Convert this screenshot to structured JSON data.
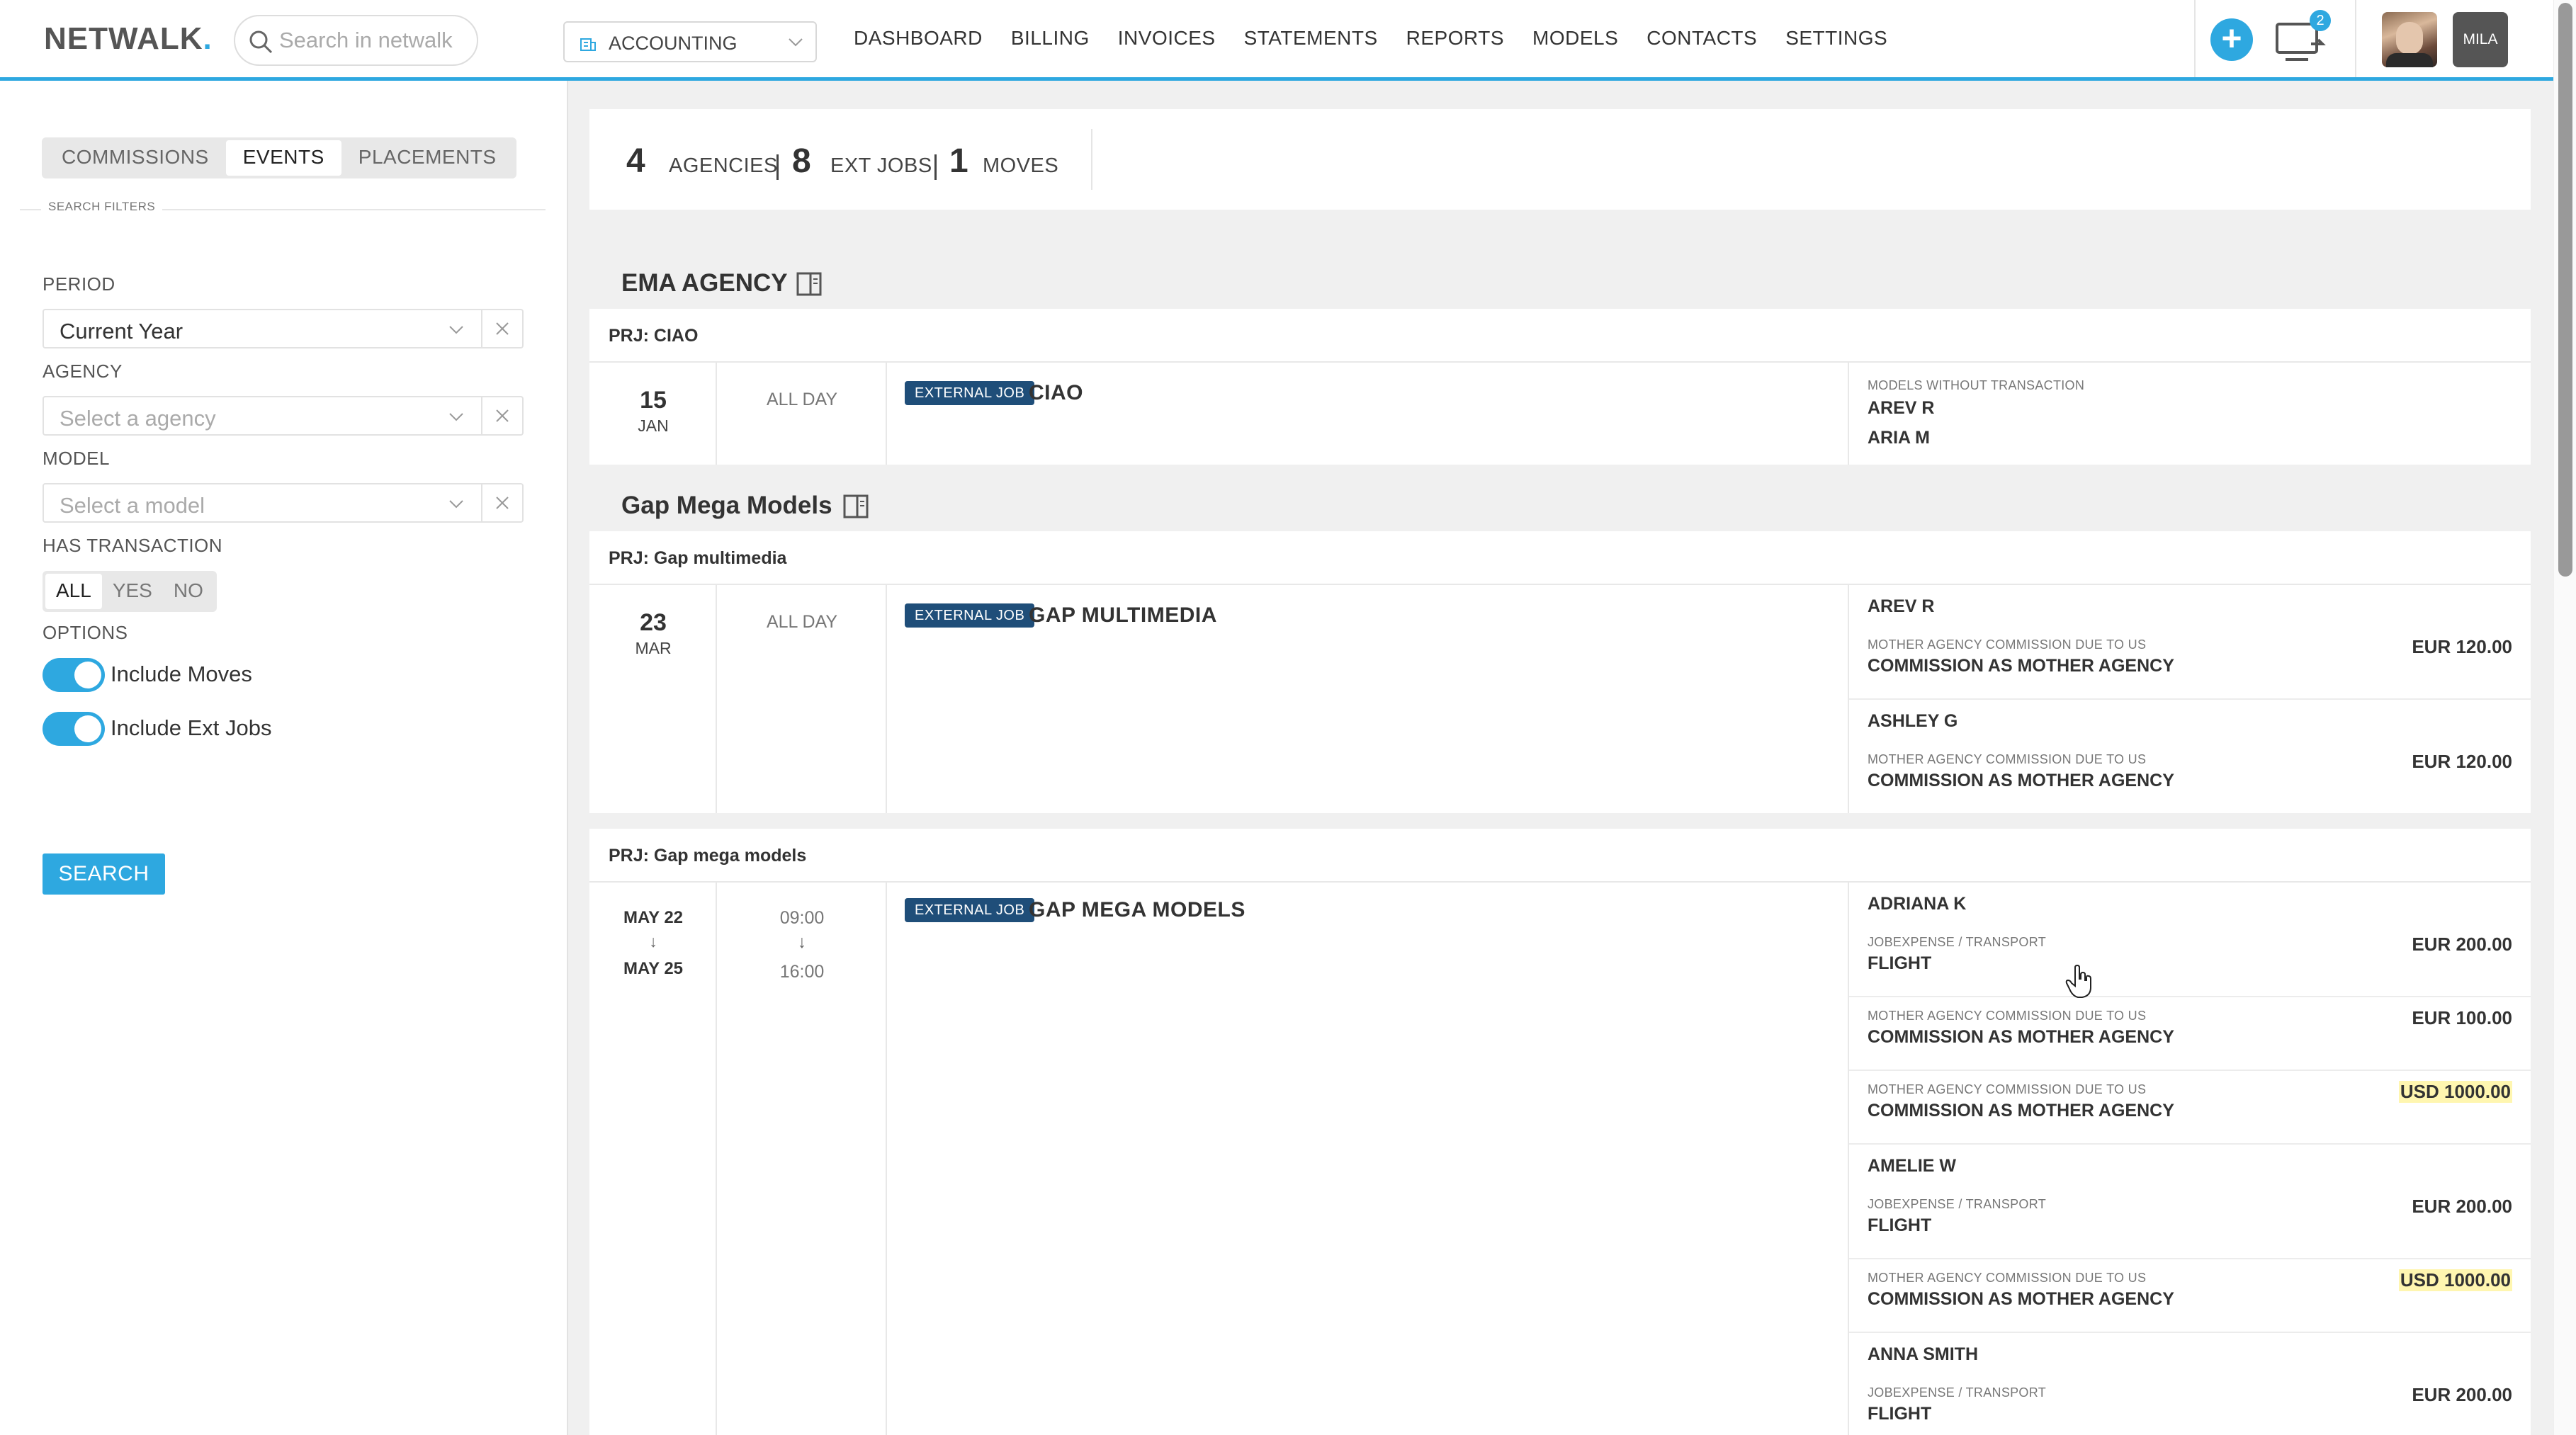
{
  "app": {
    "logo": "NETWALK",
    "logo_dot": "."
  },
  "search": {
    "placeholder": "Search in netwalk"
  },
  "department": {
    "selected": "ACCOUNTING"
  },
  "nav": {
    "items": [
      "DASHBOARD",
      "BILLING",
      "INVOICES",
      "STATEMENTS",
      "REPORTS",
      "MODELS",
      "CONTACTS",
      "SETTINGS"
    ]
  },
  "topbar": {
    "notification_count": "2",
    "user_initials": "MILA"
  },
  "sidebar": {
    "tabs": [
      "COMMISSIONS",
      "EVENTS",
      "PLACEMENTS"
    ],
    "active_tab": "EVENTS",
    "search_filters_label": "SEARCH FILTERS",
    "period": {
      "label": "PERIOD",
      "value": "Current Year"
    },
    "agency": {
      "label": "AGENCY",
      "placeholder": "Select a agency"
    },
    "model": {
      "label": "MODEL",
      "placeholder": "Select a model"
    },
    "has_transaction": {
      "label": "HAS TRANSACTION",
      "options": [
        "ALL",
        "YES",
        "NO"
      ],
      "selected": "ALL"
    },
    "options": {
      "label": "OPTIONS",
      "include_moves": "Include Moves",
      "include_ext_jobs": "Include Ext Jobs"
    },
    "search_button": "SEARCH"
  },
  "summary": {
    "agencies_count": "4",
    "agencies_label": "AGENCIES",
    "ext_jobs_count": "8",
    "ext_jobs_label": "EXT JOBS",
    "moves_count": "1",
    "moves_label": "MOVES"
  },
  "groups": [
    {
      "agency": "EMA AGENCY",
      "projects": [
        {
          "project": "PRJ: CIAO",
          "date_day": "15",
          "date_month": "JAN",
          "time": "ALL DAY",
          "tag": "EXTERNAL JOB",
          "job_name": "CIAO",
          "models_without_transaction_label": "MODELS WITHOUT TRANSACTION",
          "models": [
            "AREV R",
            "ARIA M"
          ]
        }
      ]
    },
    {
      "agency": "Gap Mega Models",
      "projects": [
        {
          "project": "PRJ: Gap multimedia",
          "date_day": "23",
          "date_month": "MAR",
          "time": "ALL DAY",
          "tag": "EXTERNAL JOB",
          "job_name": "GAP MULTIMEDIA",
          "lines": [
            {
              "model": "AREV R",
              "type": "MOTHER AGENCY COMMISSION DUE TO US",
              "title": "COMMISSION AS MOTHER AGENCY",
              "amount": "EUR 120.00"
            },
            {
              "model": "ASHLEY G",
              "type": "MOTHER AGENCY COMMISSION DUE TO US",
              "title": "COMMISSION AS MOTHER AGENCY",
              "amount": "EUR 120.00"
            }
          ]
        },
        {
          "project": "PRJ: Gap mega models",
          "date_start": "MAY 22",
          "date_arrow": "↓",
          "date_end": "MAY 25",
          "time_start": "09:00",
          "time_arrow": "↓",
          "time_end": "16:00",
          "tag": "EXTERNAL JOB",
          "job_name": "GAP MEGA MODELS",
          "lines": [
            {
              "model": "ADRIANA K",
              "type": "JOBEXPENSE / TRANSPORT",
              "title": "FLIGHT",
              "amount": "EUR 200.00"
            },
            {
              "type": "MOTHER AGENCY COMMISSION DUE TO US",
              "title": "COMMISSION AS MOTHER AGENCY",
              "amount": "EUR 100.00"
            },
            {
              "type": "MOTHER AGENCY COMMISSION DUE TO US",
              "title": "COMMISSION AS MOTHER AGENCY",
              "amount": "USD 1000.00",
              "highlight": true
            },
            {
              "model": "AMELIE W",
              "type": "JOBEXPENSE / TRANSPORT",
              "title": "FLIGHT",
              "amount": "EUR 200.00"
            },
            {
              "type": "MOTHER AGENCY COMMISSION DUE TO US",
              "title": "COMMISSION AS MOTHER AGENCY",
              "amount": "USD 1000.00",
              "highlight": true
            },
            {
              "model": "ANNA SMITH",
              "type": "JOBEXPENSE / TRANSPORT",
              "title": "FLIGHT",
              "amount": "EUR 200.00"
            }
          ]
        }
      ]
    }
  ],
  "colors": {
    "accent": "#2ea8e0",
    "tag_bg": "#1f4e79",
    "highlight": "#fff6b0"
  }
}
